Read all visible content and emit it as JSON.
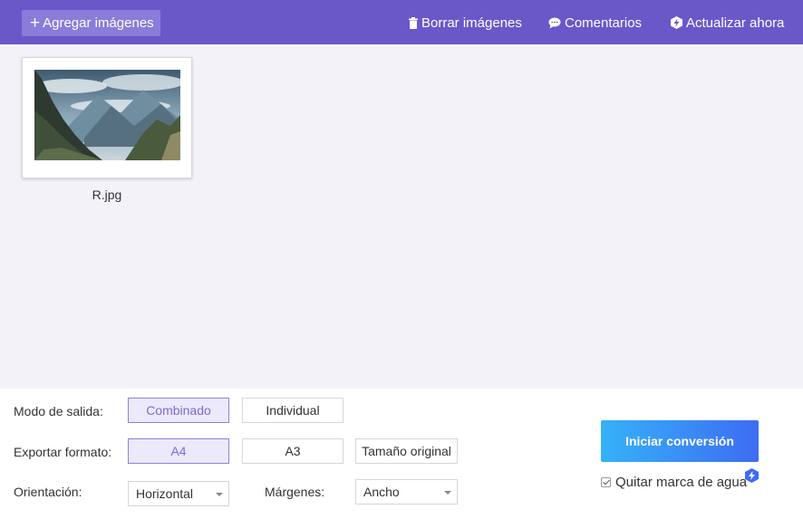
{
  "toolbar": {
    "add_images": "Agregar imágenes",
    "delete_images": "Borrar imágenes",
    "comments": "Comentarios",
    "upgrade": "Actualizar ahora"
  },
  "files": [
    {
      "name": "R.jpg"
    }
  ],
  "settings": {
    "output_mode": {
      "label": "Modo de salida:",
      "options": [
        "Combinado",
        "Individual"
      ],
      "selected": "Combinado"
    },
    "export_format": {
      "label": "Exportar formato:",
      "options": [
        "A4",
        "A3",
        "Tamaño original"
      ],
      "selected": "A4"
    },
    "orientation": {
      "label": "Orientación:",
      "value": "Horizontal"
    },
    "margins": {
      "label": "Márgenes:",
      "value": "Ancho"
    }
  },
  "actions": {
    "start": "Iniciar conversión",
    "remove_watermark": "Quitar marca de agua",
    "remove_watermark_checked": true
  },
  "colors": {
    "topbar": "#6a58c9",
    "accent": "#7a6cd4",
    "start_gradient_from": "#35b2f8",
    "start_gradient_to": "#3d6cf3",
    "premium_badge": "#3d6cf3"
  },
  "icons": {
    "add": "plus-icon",
    "delete": "trash-icon",
    "comments": "chat-bubble-icon",
    "upgrade": "hexagon-bolt-icon",
    "premium": "premium-badge-icon",
    "dropdown": "caret-down-icon"
  }
}
